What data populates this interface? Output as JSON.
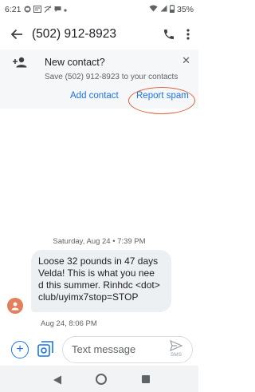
{
  "status_bar": {
    "time": "6:21",
    "battery": "35%",
    "icons": [
      "mail-icon",
      "notification-icon",
      "wifi-off-icon",
      "chat-icon",
      "dot-icon",
      "wifi-icon",
      "signal-icon",
      "battery-icon"
    ]
  },
  "app_bar": {
    "title": "(502) 912-8923",
    "icons": [
      "back-arrow-icon",
      "phone-icon",
      "more-vert-icon"
    ]
  },
  "banner": {
    "title": "New contact?",
    "subtitle": "Save (502) 912-8923 to your contacts",
    "add_contact": "Add contact",
    "report_spam": "Report spam",
    "highlight_color": "#e0613a"
  },
  "conversation": {
    "date_separator": "Saturday, Aug 24 • 7:39 PM",
    "message": {
      "lines": [
        "Loose 32 pounds in 47 days",
        "Velda! This is what you nee",
        "d this summer. Rinhdc <dot>",
        "club/uyimx7stop=STOP"
      ],
      "timestamp": "Aug 24, 8:06 PM"
    }
  },
  "compose": {
    "placeholder": "Text message",
    "send_label": "SMS"
  },
  "colors": {
    "accent": "#1a73e8",
    "avatar": "#e27f5c",
    "bubble": "#edf0f2"
  }
}
